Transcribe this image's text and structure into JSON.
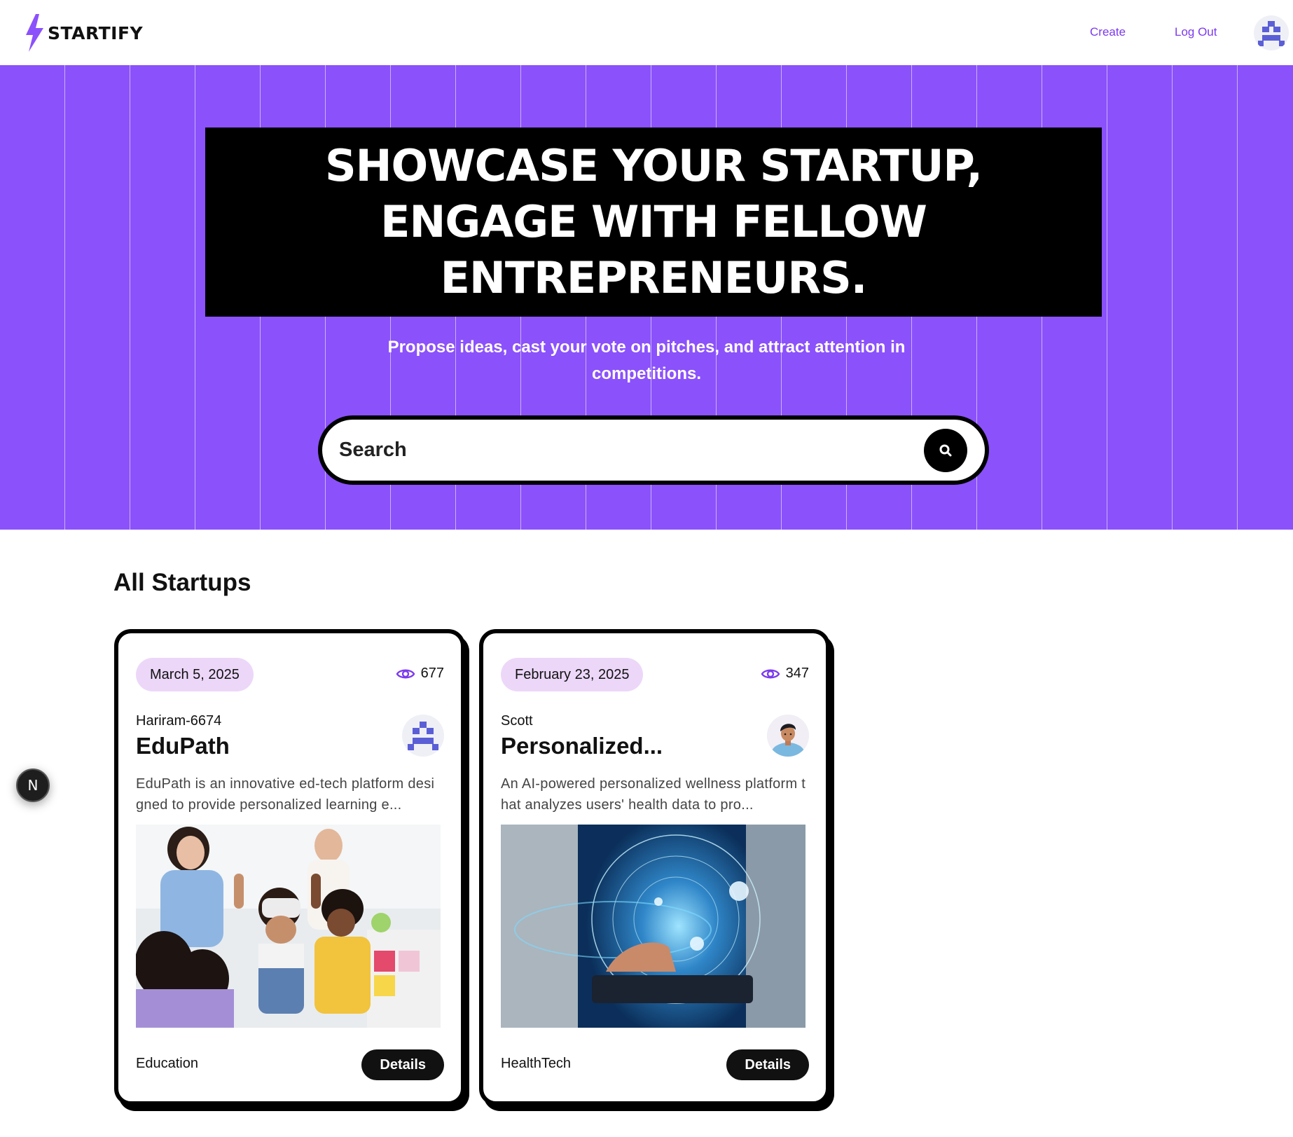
{
  "nav": {
    "brand": "STARTIFY",
    "links": {
      "create": "Create",
      "logout": "Log Out"
    },
    "brand_color": "#7c3aed"
  },
  "hero": {
    "heading": "SHOWCASE YOUR STARTUP, ENGAGE WITH FELLOW ENTREPRENEURS.",
    "subheading": "Propose ideas, cast your vote on pitches, and attract attention in competitions.",
    "search_placeholder": "Search",
    "background_color": "#8b51fb"
  },
  "section": {
    "title": "All Startups"
  },
  "startups": [
    {
      "date": "March 5, 2025",
      "views": "677",
      "author": "Hariram-6674",
      "title": "EduPath",
      "description": "EduPath is an innovative ed-tech platform designed to provide personalized learning e...",
      "category": "Education",
      "details_label": "Details",
      "author_avatar_icon": "pixel-avatar-icon"
    },
    {
      "date": "February 23, 2025",
      "views": "347",
      "author": "Scott",
      "title": "Personalized...",
      "description": "An AI-powered personalized wellness platform that analyzes users' health data to pro...",
      "category": "HealthTech",
      "details_label": "Details",
      "author_avatar_icon": "person-avatar-icon"
    }
  ],
  "dev_badge": {
    "label": "N"
  }
}
